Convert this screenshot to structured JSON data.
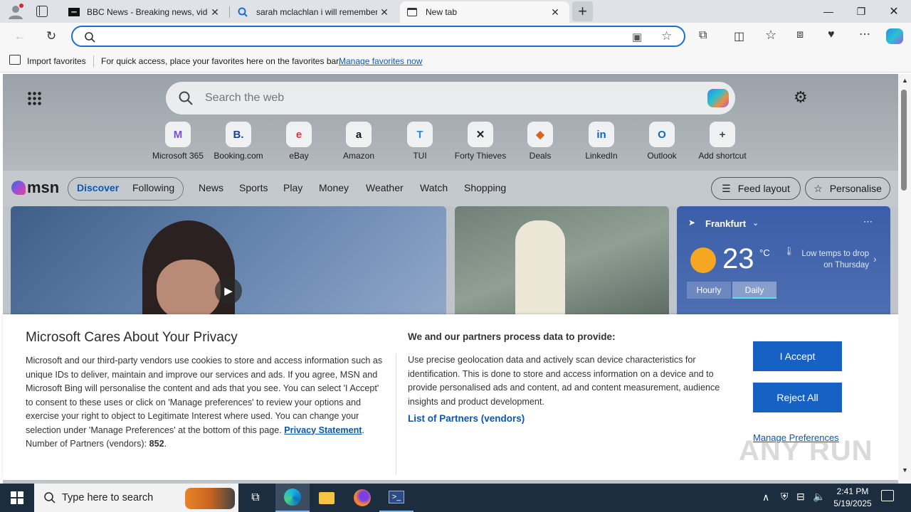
{
  "tabs": [
    {
      "title": "BBC News - Breaking news, video and more",
      "icon": "bbc-icon"
    },
    {
      "title": "sarah mclachlan i will remember you",
      "icon": "search-icon"
    },
    {
      "title": "New tab",
      "icon": "newtab-icon"
    }
  ],
  "address": {
    "placeholder": ""
  },
  "favorites": {
    "import_label": "Import favorites",
    "message": "For quick access, place your favorites here on the favorites bar.",
    "manage_link": "Manage favorites now"
  },
  "search": {
    "placeholder": "Search the web"
  },
  "shortcuts": [
    {
      "label": "Microsoft 365",
      "glyph": "M"
    },
    {
      "label": "Booking.com",
      "glyph": "B."
    },
    {
      "label": "eBay",
      "glyph": "e"
    },
    {
      "label": "Amazon",
      "glyph": "a"
    },
    {
      "label": "TUI",
      "glyph": "T"
    },
    {
      "label": "Forty Thieves",
      "glyph": "✕"
    },
    {
      "label": "Deals",
      "glyph": "◆"
    },
    {
      "label": "LinkedIn",
      "glyph": "in"
    },
    {
      "label": "Outlook",
      "glyph": "O"
    },
    {
      "label": "Add shortcut",
      "glyph": "+"
    }
  ],
  "msn": {
    "logo": "msn",
    "tabs": [
      "Discover",
      "Following"
    ],
    "nav": [
      "News",
      "Sports",
      "Play",
      "Money",
      "Weather",
      "Watch",
      "Shopping"
    ],
    "feed_layout": "Feed layout",
    "personalise": "Personalise"
  },
  "weather": {
    "city": "Frankfurt",
    "temp": "23",
    "unit": "°C",
    "note": "Low temps to drop on Thursday",
    "tab_hourly": "Hourly",
    "tab_daily": "Daily"
  },
  "privacy": {
    "title": "Microsoft Cares About Your Privacy",
    "body": "Microsoft and our third-party vendors use cookies to store and access information such as unique IDs to deliver, maintain and improve our services and ads. If you agree, MSN and Microsoft Bing will personalise the content and ads that you see. You can select 'I Accept' to consent to these uses or click on 'Manage preferences' to review your options and exercise your right to object to Legitimate Interest where used.  You can change your selection under 'Manage Preferences' at the bottom of this page.",
    "privacy_link": "Privacy Statement",
    "partners_label": "Number of Partners (vendors):",
    "partners_count": "852",
    "right_title": "We and our partners process data to provide:",
    "right_body": "Use precise geolocation data and actively scan device characteristics for identification. This is done to store and access information on a device and to provide personalised ads and content, ad and content measurement, audience insights and product development.",
    "list_link": "List of Partners (vendors)",
    "accept": "I Accept",
    "reject": "Reject All",
    "manage": "Manage Preferences"
  },
  "watermark": "ANY RUN",
  "taskbar": {
    "search_placeholder": "Type here to search",
    "time": "2:41 PM",
    "date": "5/19/2025"
  }
}
